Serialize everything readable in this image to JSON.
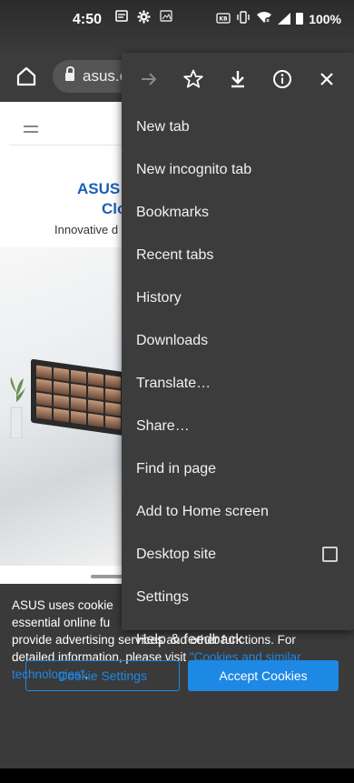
{
  "status_bar": {
    "time": "4:50",
    "left_icons": [
      "notification-icon",
      "settings-icon",
      "image-icon"
    ],
    "battery": "100%"
  },
  "toolbar": {
    "url": "asus.c"
  },
  "page": {
    "heading_line1": "ASUS a",
    "heading_line2": "Clo",
    "tagline": "Innovative d"
  },
  "cookie_banner": {
    "text_lines": [
      "ASUS uses cookie",
      "essential online fu",
      "provide advertising services and other functions. For",
      "detailed information, please visit"
    ],
    "link_text": "\"Cookies and similar technologies\"",
    "link_suffix": ".",
    "cookie_settings_label": "Cookie Settings",
    "accept_label": "Accept Cookies"
  },
  "menu": {
    "icons": [
      "forward-icon",
      "star-icon",
      "download-icon",
      "info-icon",
      "close-icon"
    ],
    "items": [
      {
        "label": "New tab"
      },
      {
        "label": "New incognito tab"
      },
      {
        "label": "Bookmarks"
      },
      {
        "label": "Recent tabs"
      },
      {
        "label": "History"
      },
      {
        "label": "Downloads"
      },
      {
        "label": "Translate…"
      },
      {
        "label": "Share…"
      },
      {
        "label": "Find in page"
      },
      {
        "label": "Add to Home screen"
      },
      {
        "label": "Desktop site",
        "checkbox": false
      },
      {
        "label": "Settings"
      },
      {
        "label": "Help & feedback"
      }
    ]
  },
  "colors": {
    "accent": "#1e88e5",
    "menu_bg": "#3c3c3c",
    "heading": "#1a5fb4"
  }
}
